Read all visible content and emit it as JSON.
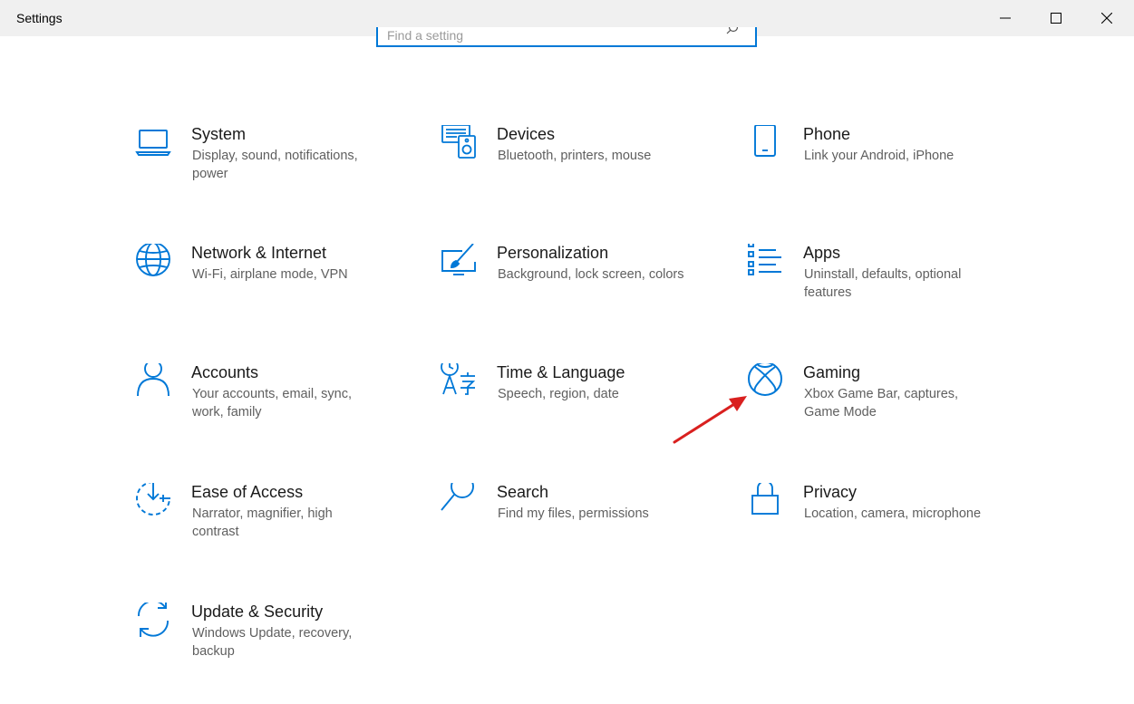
{
  "window": {
    "title": "Settings",
    "controls": {
      "minimize": "minimize",
      "maximize": "maximize",
      "close": "close"
    }
  },
  "search": {
    "placeholder": "Find a setting",
    "value": ""
  },
  "colors": {
    "accent": "#0078d7",
    "annotation_arrow": "#d9201f"
  },
  "categories": [
    {
      "key": "system",
      "title": "System",
      "description": "Display, sound, notifications, power",
      "icon": "laptop-icon"
    },
    {
      "key": "devices",
      "title": "Devices",
      "description": "Bluetooth, printers, mouse",
      "icon": "devices-icon"
    },
    {
      "key": "phone",
      "title": "Phone",
      "description": "Link your Android, iPhone",
      "icon": "phone-icon"
    },
    {
      "key": "network",
      "title": "Network & Internet",
      "description": "Wi-Fi, airplane mode, VPN",
      "icon": "globe-icon"
    },
    {
      "key": "personalization",
      "title": "Personalization",
      "description": "Background, lock screen, colors",
      "icon": "paintbrush-icon"
    },
    {
      "key": "apps",
      "title": "Apps",
      "description": "Uninstall, defaults, optional features",
      "icon": "apps-list-icon"
    },
    {
      "key": "accounts",
      "title": "Accounts",
      "description": "Your accounts, email, sync, work, family",
      "icon": "person-icon"
    },
    {
      "key": "time-language",
      "title": "Time & Language",
      "description": "Speech, region, date",
      "icon": "time-language-icon"
    },
    {
      "key": "gaming",
      "title": "Gaming",
      "description": "Xbox Game Bar, captures, Game Mode",
      "icon": "xbox-icon"
    },
    {
      "key": "ease-of-access",
      "title": "Ease of Access",
      "description": "Narrator, magnifier, high contrast",
      "icon": "ease-of-access-icon"
    },
    {
      "key": "search",
      "title": "Search",
      "description": "Find my files, permissions",
      "icon": "magnifier-icon"
    },
    {
      "key": "privacy",
      "title": "Privacy",
      "description": "Location, camera, microphone",
      "icon": "padlock-icon"
    },
    {
      "key": "update-security",
      "title": "Update & Security",
      "description": "Windows Update, recovery, backup",
      "icon": "sync-arrows-icon"
    }
  ],
  "annotation": {
    "type": "arrow",
    "points_to": "Gaming"
  }
}
